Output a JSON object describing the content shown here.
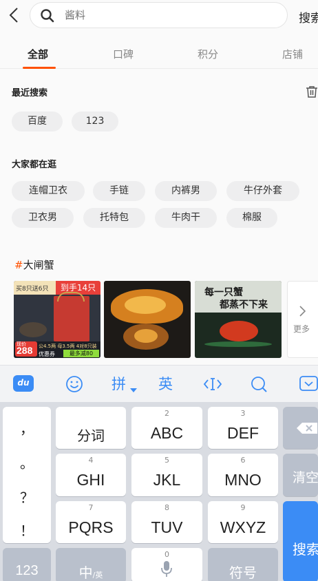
{
  "header": {
    "search_placeholder": "酱料",
    "search_button": "搜索"
  },
  "tabs": [
    "全部",
    "口碑",
    "积分",
    "店铺"
  ],
  "recent": {
    "title": "最近搜索",
    "items": [
      "百度",
      "123"
    ]
  },
  "popular": {
    "title": "大家都在逛",
    "items": [
      "连帽卫衣",
      "手链",
      "内裤男",
      "牛仔外套",
      "卫衣男",
      "托特包",
      "牛肉干",
      "棉服"
    ]
  },
  "topic": {
    "hash": "#",
    "title": "大闸蟹"
  },
  "products": {
    "p1": {
      "badge": "买8只送6只",
      "headline": "到手14只",
      "price": "288",
      "price_tag": "现价",
      "detail": "公4.5两 母3.5两 4对8只装",
      "coupon_label": "优惠券",
      "coupon_text": "最多减80"
    },
    "p2": {},
    "p3": {
      "line1": "每一只蟹",
      "line2": "都蒸不下来"
    },
    "more_label": "更多"
  },
  "keyboard": {
    "toolbar": {
      "pinyin": "拼",
      "english": "英"
    },
    "left_column": [
      "，",
      "。",
      "？",
      "！"
    ],
    "keys": [
      {
        "num": "",
        "label": "分词"
      },
      {
        "num": "2",
        "label": "ABC"
      },
      {
        "num": "3",
        "label": "DEF"
      },
      {
        "num": "4",
        "label": "GHI"
      },
      {
        "num": "5",
        "label": "JKL"
      },
      {
        "num": "6",
        "label": "MNO"
      },
      {
        "num": "7",
        "label": "PQRS"
      },
      {
        "num": "8",
        "label": "TUV"
      },
      {
        "num": "9",
        "label": "WXYZ"
      }
    ],
    "clear": "清空",
    "search": "搜索",
    "bottom": {
      "num_key": "123",
      "lang_main": "中",
      "lang_sub": "/英",
      "space_num": "0",
      "symbols": "符号"
    }
  },
  "colors": {
    "accent": "#ff5000",
    "keyboard_blue": "#3b8cf5"
  }
}
